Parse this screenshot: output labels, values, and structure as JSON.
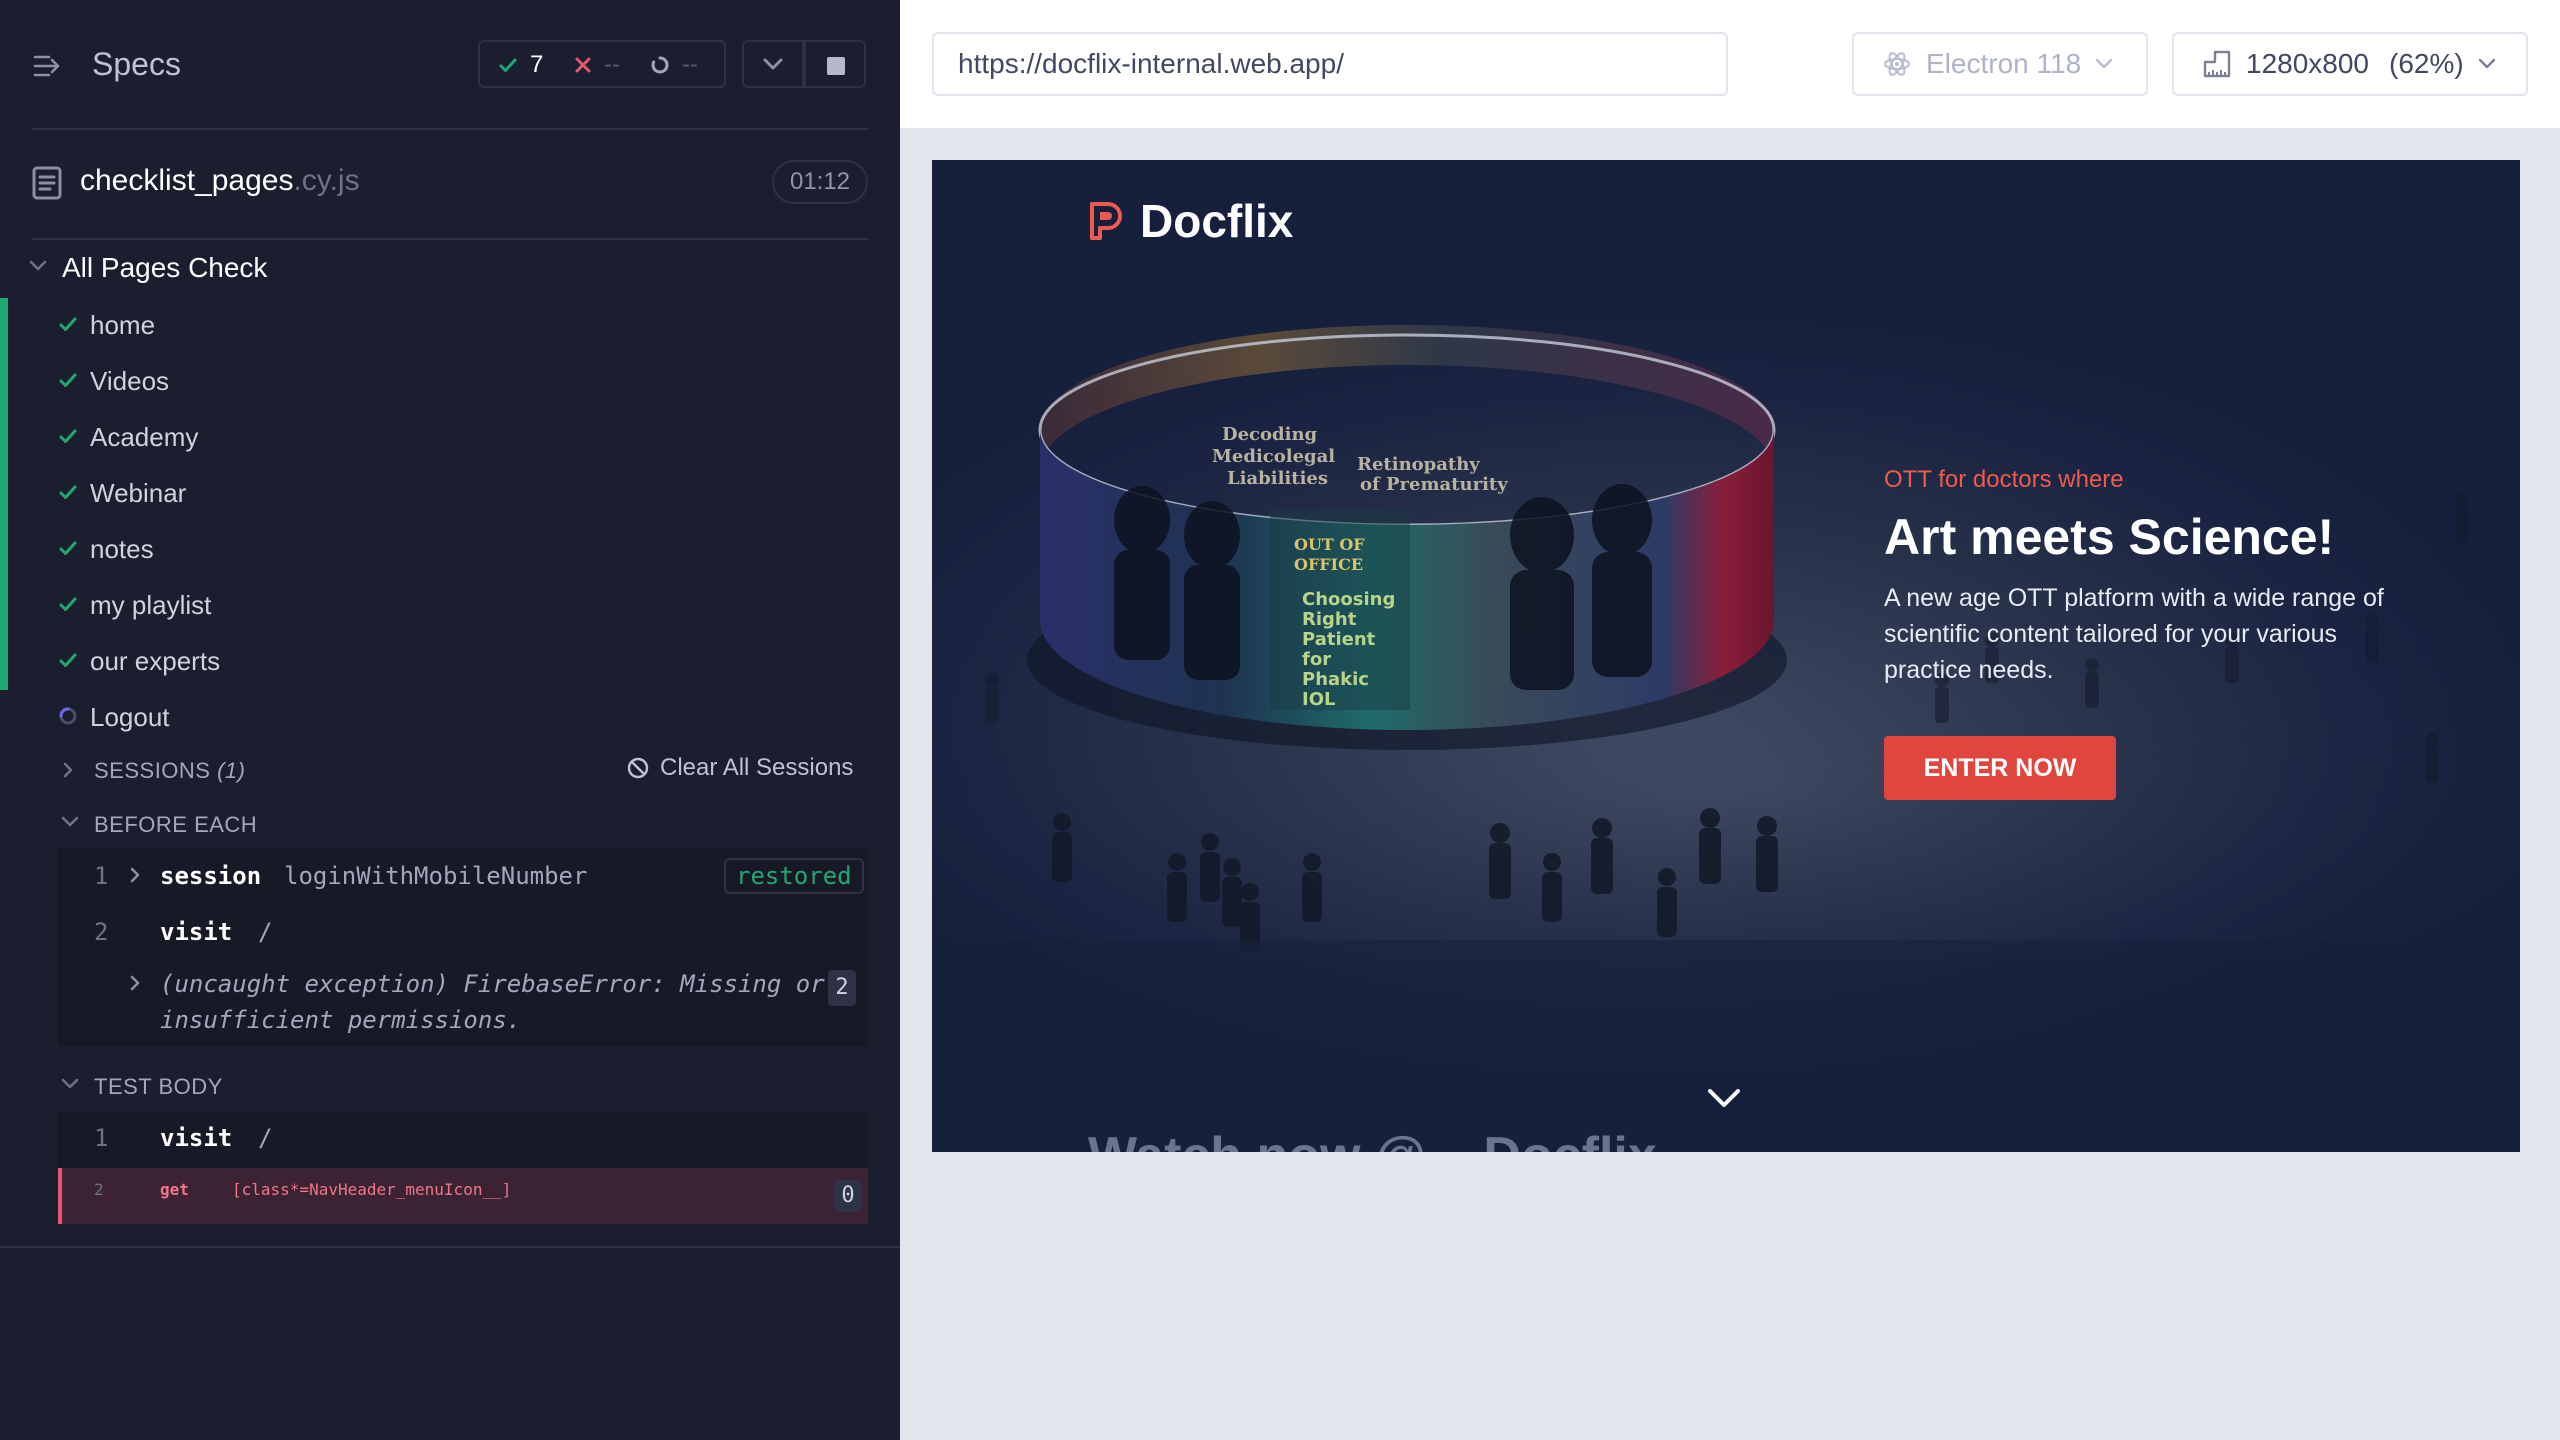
{
  "reporter": {
    "title": "Specs",
    "stats": {
      "passed": "7",
      "failed": "--",
      "pending": "--"
    },
    "file": {
      "name": "checklist_pages",
      "ext": ".cy.js",
      "duration": "01:12"
    },
    "suite": {
      "title": "All Pages Check",
      "tests": [
        {
          "label": "home",
          "state": "passed"
        },
        {
          "label": "Videos",
          "state": "passed"
        },
        {
          "label": "Academy",
          "state": "passed"
        },
        {
          "label": "Webinar",
          "state": "passed"
        },
        {
          "label": "notes",
          "state": "passed"
        },
        {
          "label": "my playlist",
          "state": "passed"
        },
        {
          "label": "our experts",
          "state": "passed"
        },
        {
          "label": "Logout",
          "state": "running"
        }
      ]
    },
    "sessions": {
      "label": "SESSIONS",
      "count": "(1)",
      "clear_label": "Clear All Sessions"
    },
    "before_each": {
      "label": "BEFORE EACH",
      "commands": [
        {
          "num": "1",
          "name": "session",
          "arg": "loginWithMobileNumber",
          "badge": "restored"
        },
        {
          "num": "2",
          "name": "visit",
          "arg": "/"
        }
      ],
      "exception": {
        "text": "(uncaught exception)  FirebaseError: Missing or insufficient permissions.",
        "count": "2"
      }
    },
    "test_body": {
      "label": "TEST BODY",
      "commands": [
        {
          "num": "1",
          "name": "visit",
          "arg": "/"
        },
        {
          "num": "2",
          "name": "get",
          "arg": "[class*=NavHeader_menuIcon__]",
          "count": "0"
        }
      ]
    }
  },
  "aut": {
    "url": "https://docflix-internal.web.app/",
    "browser": "Electron 118",
    "viewport": "1280x800",
    "scale": "(62%)",
    "site": {
      "logo": "Docflix",
      "eyebrow": "OTT for doctors where",
      "title": "Art meets Science!",
      "description": "A new age OTT platform with a wide range of scientific content tailored for your various practice needs.",
      "cta": "ENTER NOW",
      "next_heading": "Watch now @ ...Docflix"
    }
  },
  "colors": {
    "pass": "#1fa971",
    "fail": "#e45770",
    "accent": "#e0463e",
    "running": "#6f6cf0"
  }
}
